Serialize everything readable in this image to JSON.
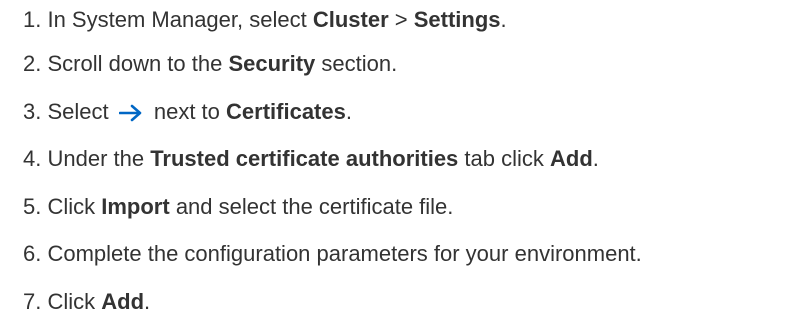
{
  "steps": [
    {
      "number": "1.",
      "t1": " In System Manager, select ",
      "b1": "Cluster",
      "t2": " > ",
      "b2": "Settings",
      "t3": "."
    },
    {
      "number": "2.",
      "t1": " Scroll down to the ",
      "b1": "Security",
      "t2": " section."
    },
    {
      "number": "3.",
      "t1": " Select ",
      "icon": "arrow-right-icon",
      "t2": " next to ",
      "b1": "Certificates",
      "t3": "."
    },
    {
      "number": "4.",
      "t1": " Under the ",
      "b1": "Trusted certificate authorities",
      "t2": " tab click ",
      "b2": "Add",
      "t3": "."
    },
    {
      "number": "5.",
      "t1": " Click ",
      "b1": "Import",
      "t2": " and select the certificate file."
    },
    {
      "number": "6.",
      "t1": " Complete the configuration parameters for your environment."
    },
    {
      "number": "7.",
      "t1": " Click ",
      "b1": "Add",
      "t2": "."
    }
  ],
  "colors": {
    "text": "#333333",
    "arrow": "#0067c5"
  }
}
